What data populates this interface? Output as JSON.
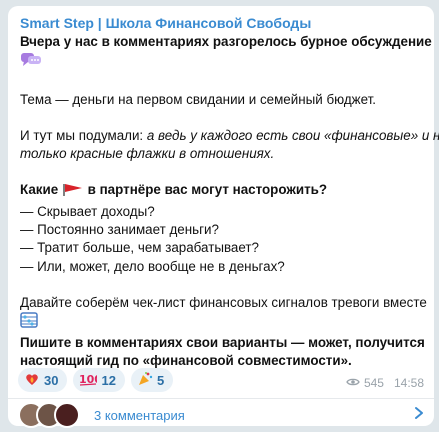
{
  "channel": {
    "title": "Smart Step | Школа Финансовой Свободы"
  },
  "post": {
    "line1": "Вчера у нас в комментариях разгорелось бурное обсуждение",
    "topic": "Тема — деньги на первом свидании и семейный бюджет.",
    "thought_prefix": "И тут мы подумали: ",
    "thought_italic_1": "а ведь у каждого есть свои «финансовые» и не",
    "thought_italic_2": "только красные флажки в отношениях.",
    "question_a": "Какие",
    "question_b": "в партнёре вас могут насторожить?",
    "items": [
      "— Скрывает доходы?",
      "— Постоянно занимает деньги?",
      "— Тратит больше, чем зарабатывает?",
      "— Или, может, дело вообще не в деньгах?"
    ],
    "checklist": "Давайте соберём чек-лист финансовых сигналов тревоги вместе",
    "cta_1": "Пишите в комментариях свои варианты — может, получится",
    "cta_2": "настоящий гид по «финансовой совместимости»."
  },
  "reactions": [
    {
      "icon": "heart-fire-icon",
      "count": "30"
    },
    {
      "icon": "hundred-icon",
      "count": "12"
    },
    {
      "icon": "party-popper-icon",
      "count": "5"
    }
  ],
  "meta": {
    "views": "545",
    "time": "14:58"
  },
  "comments": {
    "label": "3 комментария"
  },
  "colors": {
    "accent": "#3a8bd1",
    "background": "#dfe6ea",
    "bubble": "#ffffff"
  }
}
